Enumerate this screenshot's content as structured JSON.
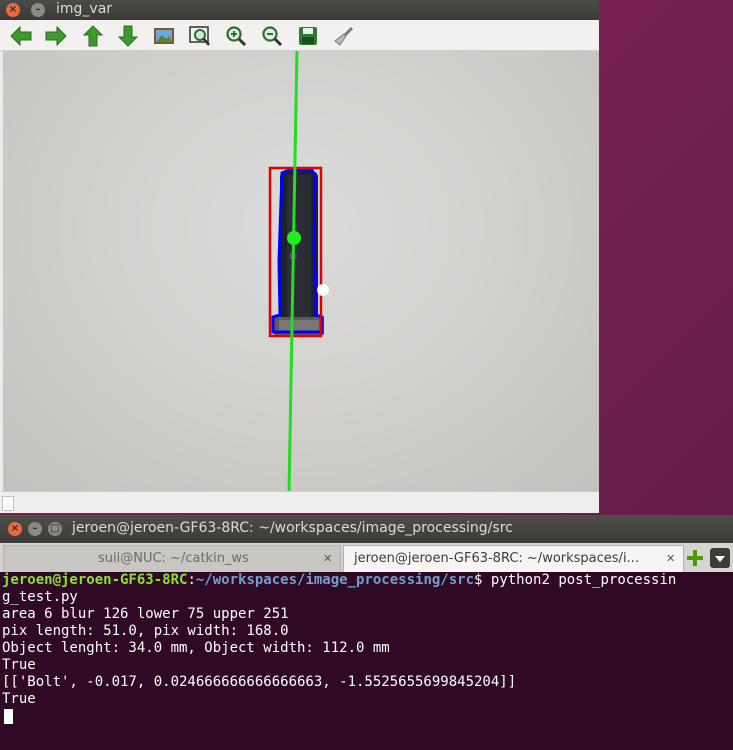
{
  "image_window": {
    "title": "img_var",
    "toolbar": [
      {
        "name": "arrow-left-icon"
      },
      {
        "name": "arrow-right-icon"
      },
      {
        "name": "arrow-up-icon"
      },
      {
        "name": "arrow-down-icon"
      },
      {
        "name": "picture-icon"
      },
      {
        "name": "zoom-fit-icon"
      },
      {
        "name": "zoom-in-icon"
      },
      {
        "name": "zoom-out-icon"
      },
      {
        "name": "save-icon"
      },
      {
        "name": "brush-icon"
      }
    ],
    "colors": {
      "bounding_box": "#e00000",
      "contour": "#0000ff",
      "axis_line": "#22dd22",
      "centroid": "#22ee22"
    }
  },
  "terminal": {
    "title": "jeroen@jeroen-GF63-8RC: ~/workspaces/image_processing/src",
    "tabs": [
      {
        "label": "suii@NUC: ~/catkin_ws",
        "active": false
      },
      {
        "label": "jeroen@jeroen-GF63-8RC: ~/workspaces/i...",
        "active": true
      }
    ],
    "prompt_user": "jeroen@jeroen-GF63-8RC",
    "prompt_path": "~/workspaces/image_processing/src",
    "prompt_sep": ":",
    "prompt_symbol": "$ ",
    "command_line1": "python2 post_processin",
    "command_line2": "g_test.py",
    "output": [
      "area 6 blur 126 lower 75 upper 251",
      "pix length: 51.0, pix width: 168.0",
      "Object lenght: 34.0 mm, Object width: 112.0 mm",
      "True",
      "[['Bolt', -0.017, 0.024666666666666663, -1.5525655699845204]]",
      "True"
    ],
    "colors": {
      "background": "#300a24",
      "prompt_user": "#8ae234",
      "prompt_path": "#729fcf"
    }
  }
}
